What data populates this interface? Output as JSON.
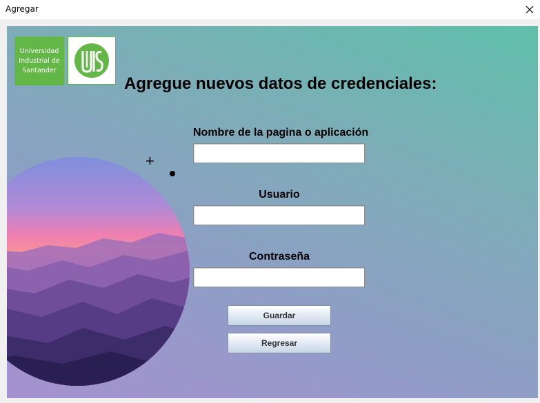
{
  "window": {
    "title": "Agregar",
    "close_icon": "close-icon"
  },
  "logo": {
    "text_line1": "Universidad",
    "text_line2": "Industrial de",
    "text_line3": "Santander",
    "emblem": "UIS",
    "colors": {
      "green": "#63b746",
      "white": "#ffffff"
    }
  },
  "form": {
    "heading": "Agregue nuevos datos de credenciales:",
    "site_label": "Nombre de la pagina o aplicación",
    "site_value": "",
    "user_label": "Usuario",
    "user_value": "",
    "password_label": "Contraseña",
    "password_value": ""
  },
  "buttons": {
    "save_label": "Guardar",
    "back_label": "Regresar"
  },
  "decorations": {
    "plus_icon": "plus-icon",
    "dot_icon": "dot-icon",
    "mountain_image": "mountain-sunset-circle"
  },
  "colors": {
    "background_top_right": "#5fbfaa",
    "background_bottom_left": "#a591d0"
  }
}
